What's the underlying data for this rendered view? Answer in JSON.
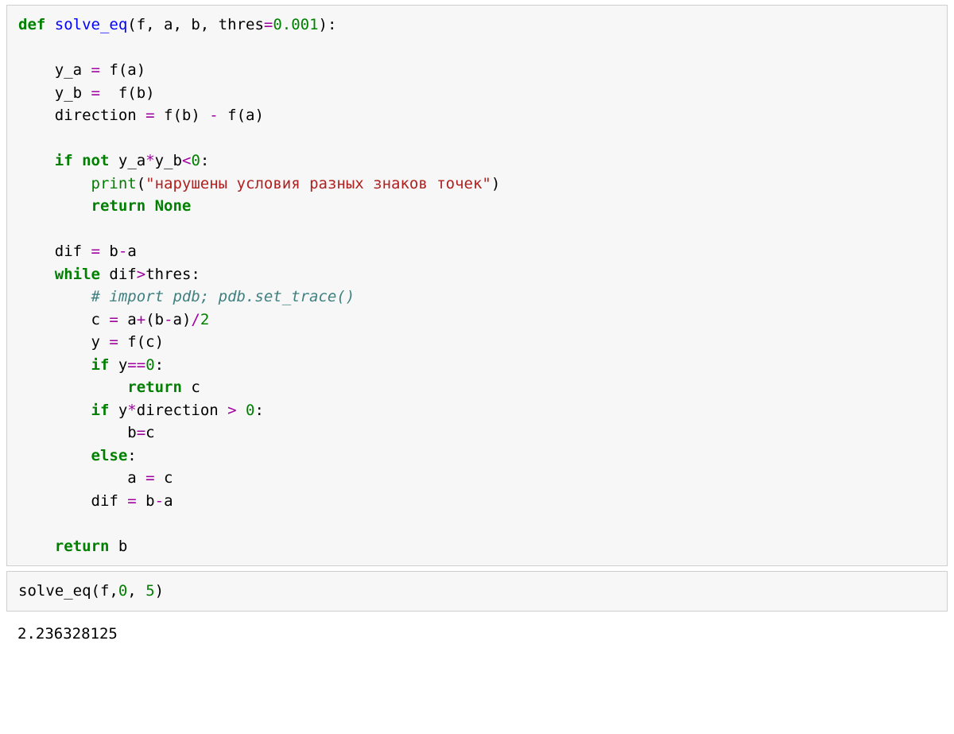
{
  "cell1": {
    "line1": {
      "def": "def",
      "fname": "solve_eq",
      "paren": "(f, a, b, thres",
      "eq": "=",
      "num": "0.001",
      "close": "):"
    },
    "line3": {
      "pre": "    y_a ",
      "op": "=",
      "post": " f(a)"
    },
    "line4": {
      "pre": "    y_b ",
      "op": "=",
      "post": "  f(b)"
    },
    "line5": {
      "pre": "    direction ",
      "op": "=",
      "mid": " f(b) ",
      "op2": "-",
      "post": " f(a)"
    },
    "line7": {
      "indent": "    ",
      "if": "if",
      "sp": " ",
      "not": "not",
      "post": " y_a",
      "star": "*",
      "yb": "y_b",
      "lt": "<",
      "zero": "0",
      "colon": ":"
    },
    "line8": {
      "indent": "        ",
      "print": "print",
      "open": "(",
      "str": "\"нарушены условия разных знаков точек\"",
      "close": ")"
    },
    "line9": {
      "indent": "        ",
      "ret": "return",
      "sp": " ",
      "none": "None"
    },
    "line11": {
      "pre": "    dif ",
      "op": "=",
      "post": " b",
      "op2": "-",
      "a": "a"
    },
    "line12": {
      "indent": "    ",
      "while": "while",
      "post": " dif",
      "gt": ">",
      "thres": "thres:"
    },
    "line13": {
      "indent": "        ",
      "cmt": "# import pdb; pdb.set_trace()"
    },
    "line14": {
      "pre": "        c ",
      "op": "=",
      "post": " a",
      "plus": "+",
      "open": "(b",
      "minus": "-",
      "a": "a)",
      "div": "/",
      "two": "2"
    },
    "line15": {
      "pre": "        y ",
      "op": "=",
      "post": " f(c)"
    },
    "line16": {
      "indent": "        ",
      "if": "if",
      "post": " y",
      "eqeq": "==",
      "zero": "0",
      "colon": ":"
    },
    "line17": {
      "indent": "            ",
      "ret": "return",
      "post": " c"
    },
    "line18": {
      "indent": "        ",
      "if": "if",
      "post": " y",
      "star": "*",
      "dir": "direction ",
      "gt": ">",
      "sp": " ",
      "zero": "0",
      "colon": ":"
    },
    "line19": {
      "pre": "            b",
      "op": "=",
      "c": "c"
    },
    "line20": {
      "indent": "        ",
      "else": "else",
      "colon": ":"
    },
    "line21": {
      "pre": "            a ",
      "op": "=",
      "post": " c"
    },
    "line22": {
      "pre": "        dif ",
      "op": "=",
      "post": " b",
      "minus": "-",
      "a": "a"
    },
    "line24": {
      "indent": "    ",
      "ret": "return",
      "post": " b"
    }
  },
  "cell2": {
    "pre": "solve_eq(f,",
    "zero": "0",
    "comma": ", ",
    "five": "5",
    "close": ")"
  },
  "output": "2.236328125"
}
